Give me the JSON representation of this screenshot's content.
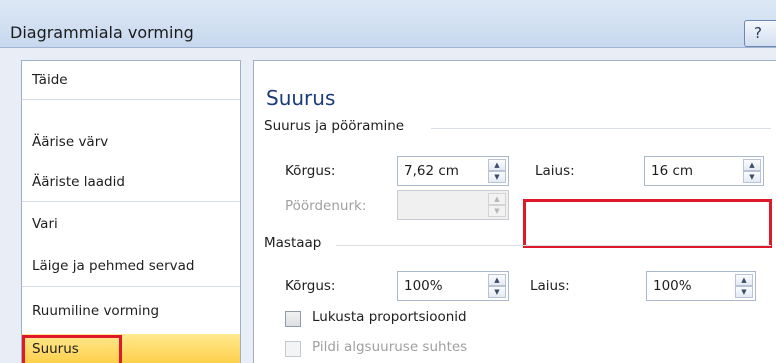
{
  "dialog": {
    "title": "Diagrammiala vorming",
    "help_glyph": "?"
  },
  "nav": {
    "items": [
      {
        "label": "Täide"
      },
      {
        "label": "Äärise värv"
      },
      {
        "label": "Ääriste laadid"
      },
      {
        "label": "Vari"
      },
      {
        "label": "Läige ja pehmed servad"
      },
      {
        "label": "Ruumiline vorming"
      },
      {
        "label": "Suurus"
      }
    ],
    "selected": "Suurus"
  },
  "panel": {
    "title": "Suurus",
    "size_rotation": {
      "section_label": "Suurus ja pööramine",
      "height_label": "Kõrgus:",
      "height_value": "7,62 cm",
      "width_label": "Laius:",
      "width_value": "16 cm",
      "rotation_label": "Pöördenurk:",
      "rotation_value": ""
    },
    "scale": {
      "section_label": "Mastaap",
      "height_label": "Kõrgus:",
      "height_value": "100%",
      "width_label": "Laius:",
      "width_value": "100%",
      "lock_aspect_label": "Lukusta proportsioonid",
      "relative_label": "Pildi algsuuruse suhtes"
    }
  },
  "colors": {
    "highlight": "#e0192a",
    "selected_item": "#ffd75e",
    "title_text": "#1a3b7a"
  },
  "icons": {
    "spin_up": "▲",
    "spin_down": "▼"
  }
}
